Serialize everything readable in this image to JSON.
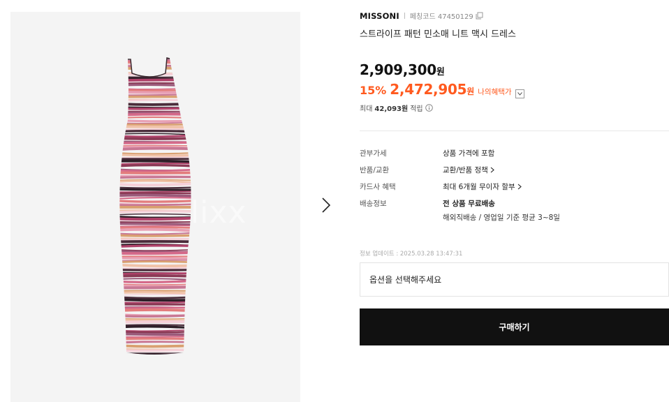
{
  "product": {
    "brand": "MISSONI",
    "code_label": "페칭코드 47450129",
    "title": "스트라이프 패턴 민소매 니트 맥시 드레스",
    "price": "2,909,300",
    "price_unit": "원",
    "discount_percent": "15%",
    "sale_price": "2,472,905",
    "sale_unit": "원",
    "my_benefit_label": "나의혜택가",
    "points_prefix": "최대",
    "points_amount": "42,093원",
    "points_suffix": "적립"
  },
  "gallery": {
    "watermark": "lixx",
    "icons": {
      "next": "chevron-right-icon"
    }
  },
  "details": [
    {
      "key": "관부가세",
      "value": "상품 가격에 포함"
    },
    {
      "key": "반품/교환",
      "value": "교환/반품 정책"
    },
    {
      "key": "카드사 혜택",
      "value": "최대 6개월 무이자 할부"
    },
    {
      "key": "배송정보",
      "value": "전 상품 무료배송",
      "sub": "해외직배송 / 영업일 기준 평균 3~8일"
    }
  ],
  "update_info": "정보 업데이트 : 2025.03.28 13:47:31",
  "option_placeholder": "옵션을 선택해주세요",
  "buy_button": "구매하기",
  "colors": {
    "accent": "#ff5a1f",
    "button": "#111111",
    "gallery_bg": "#f4f4f4"
  }
}
